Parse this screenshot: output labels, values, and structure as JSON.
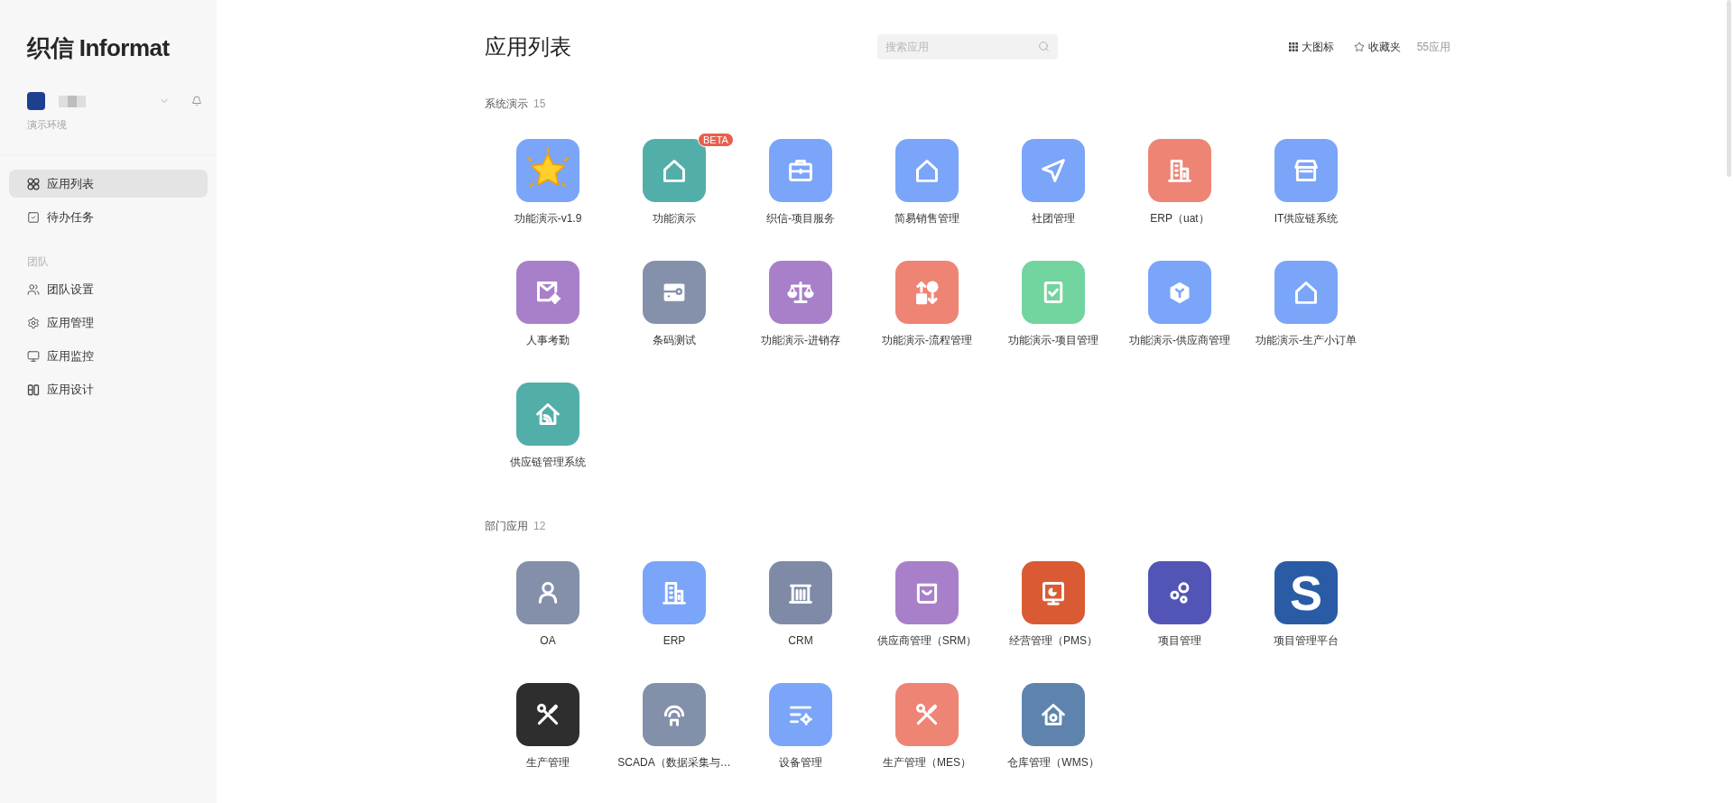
{
  "sidebar": {
    "logo": "织信 Informat",
    "environment": "演示环境",
    "groups": [
      {
        "items": [
          {
            "label": "应用列表",
            "selected": true
          },
          {
            "label": "待办任务",
            "selected": false
          }
        ]
      },
      {
        "heading": "团队",
        "items": [
          {
            "label": "团队设置",
            "selected": false
          },
          {
            "label": "应用管理",
            "selected": false
          },
          {
            "label": "应用监控",
            "selected": false
          },
          {
            "label": "应用设计",
            "selected": false
          }
        ]
      }
    ]
  },
  "header": {
    "title": "应用列表",
    "search": {
      "placeholder": "搜索应用"
    },
    "view_button": "大图标",
    "favorites_button": "收藏夹",
    "app_count": "55应用"
  },
  "sections": [
    {
      "title": "系统演示",
      "count": "15",
      "apps": [
        {
          "name": "功能演示-v1.9",
          "color": "#7aa5f8"
        },
        {
          "name": "功能演示",
          "color": "#52aea9",
          "badge": "BETA"
        },
        {
          "name": "织信-项目服务",
          "color": "#7aa5f8"
        },
        {
          "name": "简易销售管理",
          "color": "#7aa5f8"
        },
        {
          "name": "社团管理",
          "color": "#7aa5f8"
        },
        {
          "name": "ERP（uat）",
          "color": "#ee8474"
        },
        {
          "name": "IT供应链系统",
          "color": "#7aa5f8"
        },
        {
          "name": "人事考勤",
          "color": "#a880c9"
        },
        {
          "name": "条码测试",
          "color": "#8591ab"
        },
        {
          "name": "功能演示-进销存",
          "color": "#a880c9"
        },
        {
          "name": "功能演示-流程管理",
          "color": "#ee8474"
        },
        {
          "name": "功能演示-项目管理",
          "color": "#72d49e"
        },
        {
          "name": "功能演示-供应商管理",
          "color": "#7aa5f8"
        },
        {
          "name": "功能演示-生产小订单",
          "color": "#7aa5f8"
        },
        {
          "name": "供应链管理系统",
          "color": "#52aea9"
        }
      ]
    },
    {
      "title": "部门应用",
      "count": "12",
      "apps": [
        {
          "name": "OA",
          "color": "#8490aa"
        },
        {
          "name": "ERP",
          "color": "#7aa5f8"
        },
        {
          "name": "CRM",
          "color": "#7f8ba6"
        },
        {
          "name": "供应商管理（SRM）",
          "color": "#a880c9"
        },
        {
          "name": "经营管理（PMS）",
          "color": "#da5b33"
        },
        {
          "name": "项目管理",
          "color": "#5255b5"
        },
        {
          "name": "项目管理平台",
          "color": "#2a5ca6",
          "logo_text": "S"
        },
        {
          "name": "生产管理",
          "color": "#2e2e2e"
        },
        {
          "name": "SCADA（数据采集与…",
          "color": "#8390aa"
        },
        {
          "name": "设备管理",
          "color": "#7aa5f8"
        },
        {
          "name": "生产管理（MES）",
          "color": "#ee8474"
        },
        {
          "name": "仓库管理（WMS）",
          "color": "#5e84ae"
        }
      ]
    }
  ]
}
